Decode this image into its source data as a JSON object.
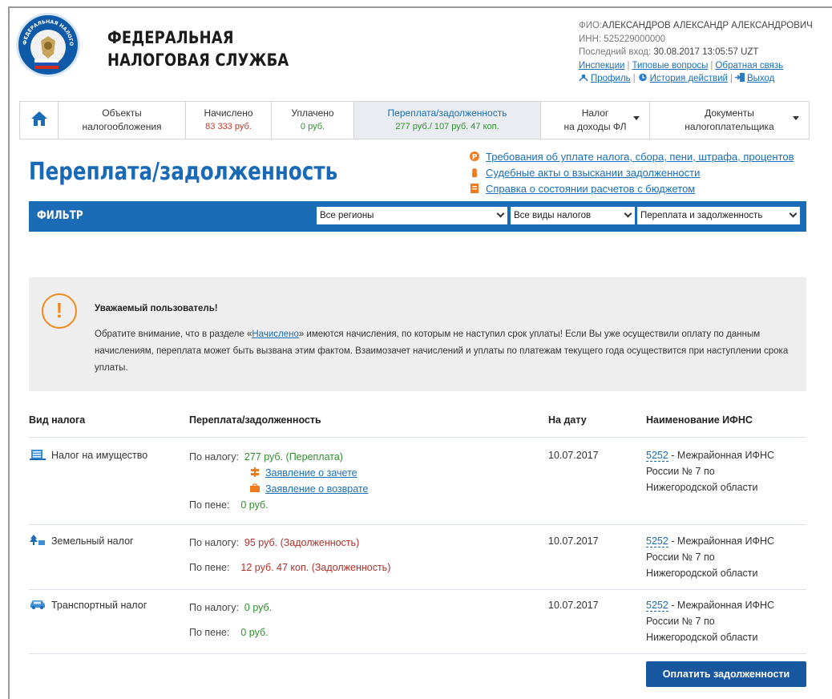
{
  "header": {
    "org_line1": "ФЕДЕРАЛЬНАЯ",
    "org_line2": "НАЛОГОВАЯ СЛУЖБА",
    "logo_text": "ФЕДЕРАЛЬНАЯ НАЛОГОВАЯ СЛУЖБА",
    "fio_label": "ФИО:",
    "fio_value": "АЛЕКСАНДРОВ  АЛЕКСАНДР АЛЕКСАНДРОВИЧ",
    "inn_label": "ИНН:",
    "inn_value": "525229000000",
    "last_login_label": "Последний вход:",
    "last_login_value": "30.08.2017 13:05:57 UZT",
    "links": {
      "inspections": "Инспекции",
      "faq": "Типовые вопросы",
      "feedback": "Обратная связь",
      "profile": "Профиль",
      "history": "История действий",
      "logout": "Выход"
    }
  },
  "tabs": [
    {
      "line1": "Объекты",
      "line2": "налогообложения"
    },
    {
      "line1": "Начислено",
      "line2": "83 333 руб."
    },
    {
      "line1": "Уплачено",
      "line2": "0 руб."
    },
    {
      "line1": "Переплата/задолженность",
      "line2": "277 руб./ 107 руб. 47 коп."
    },
    {
      "line1": "Налог",
      "line2": "на доходы ФЛ"
    },
    {
      "line1": "Документы",
      "line2": "налогоплательщика"
    }
  ],
  "page_title": "Переплата/задолженность",
  "quick_links": [
    "Требования об уплате налога, сбора, пени, штрафа, процентов",
    "Судебные акты о взыскании задолженности",
    "Справка о состоянии расчетов с бюджетом"
  ],
  "filter": {
    "label": "ФИЛЬТР",
    "region": "Все регионы",
    "tax_type": "Все виды налогов",
    "balance": "Переплата и задолженность"
  },
  "notice": {
    "title": "Уважаемый пользователь!",
    "text_before": "Обратите внимание, что в разделе «",
    "link": "Начислено",
    "text_after": "» имеются начисления, по которым не наступил срок уплаты! Если Вы уже осуществили оплату по данным начислениям, переплата может быть вызвана этим фактом. Взаимозачет начислений и уплаты по платежам текущего года осуществится при наступлении срока уплаты."
  },
  "table": {
    "headers": {
      "tax_type": "Вид налога",
      "balance": "Переплата/задолженность",
      "date": "На дату",
      "ifns": "Наименование ИФНС"
    },
    "by_tax_label": "По налогу:",
    "by_penalty_label": "По пене:",
    "rows": [
      {
        "name": "Налог на имущество",
        "tax": "277 руб. (Переплата)",
        "offset_link": "Заявление о зачете",
        "refund_link": "Заявление о возврате",
        "penalty": "0 руб.",
        "date": "10.07.2017",
        "ifns_code": "5252",
        "ifns_name1": " - Межрайонная ИФНС",
        "ifns_name2": "России № 7 по",
        "ifns_name3": "Нижегородской области"
      },
      {
        "name": "Земельный налог",
        "tax": "95 руб. (Задолженность)",
        "penalty": "12 руб. 47 коп. (Задолженность)",
        "date": "10.07.2017",
        "ifns_code": "5252",
        "ifns_name1": " - Межрайонная ИФНС",
        "ifns_name2": "России № 7 по",
        "ifns_name3": "Нижегородской области"
      },
      {
        "name": "Транспортный налог",
        "tax": "0 руб.",
        "penalty": "0 руб.",
        "date": "10.07.2017",
        "ifns_code": "5252",
        "ifns_name1": " - Межрайонная ИФНС",
        "ifns_name2": "России № 7 по",
        "ifns_name3": "Нижегородской области"
      }
    ]
  },
  "pay_button": "Оплатить задолженности"
}
